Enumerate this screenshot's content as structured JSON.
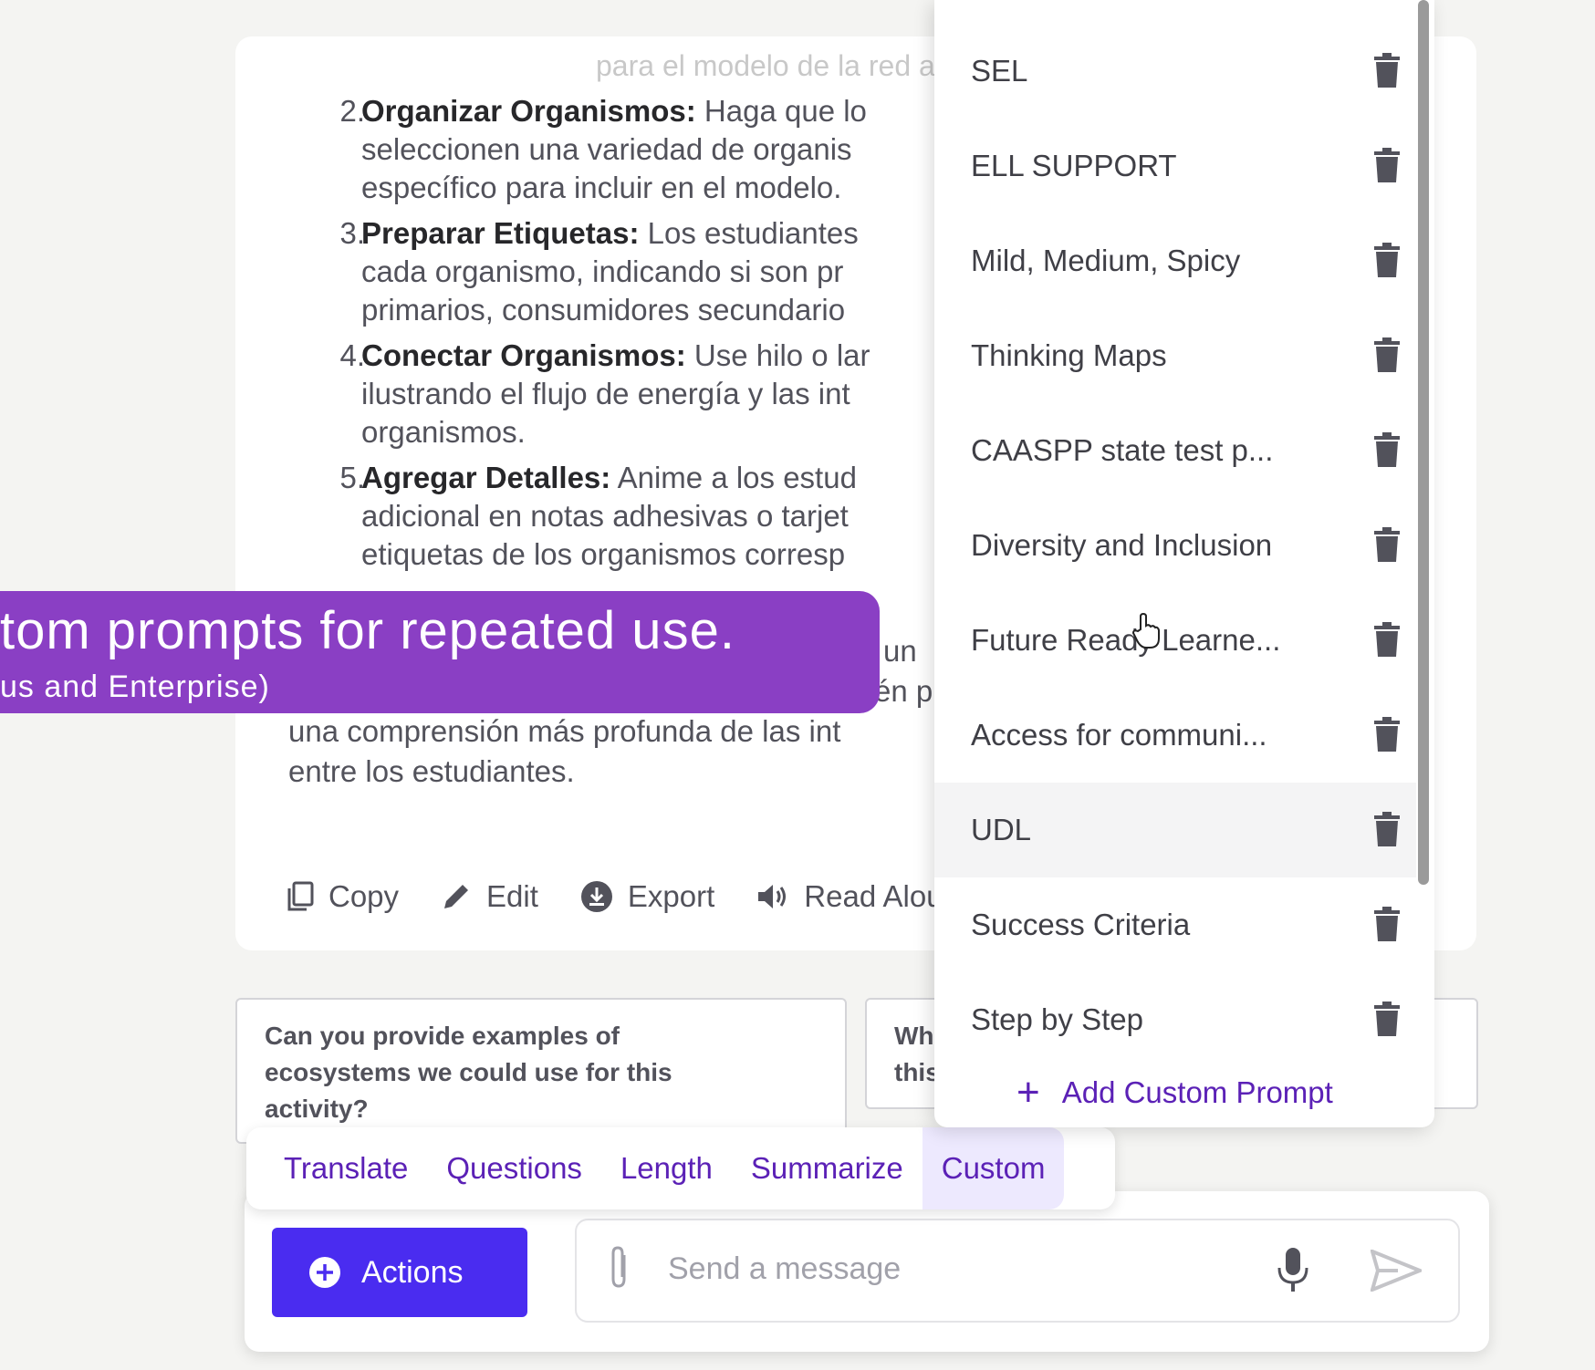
{
  "response": {
    "faded_line": "para el modelo de la red alimentaria",
    "steps": [
      {
        "num": "2.",
        "lines": [
          {
            "bold": "Organizar Organismos:",
            "text": " Haga que lo"
          },
          {
            "bold": "",
            "text": "seleccionen una variedad de organis"
          },
          {
            "bold": "",
            "text": "específico para incluir en el modelo."
          }
        ]
      },
      {
        "num": "3.",
        "lines": [
          {
            "bold": "Preparar Etiquetas:",
            "text": " Los estudiantes"
          },
          {
            "bold": "",
            "text": "cada organismo, indicando si son pr"
          },
          {
            "bold": "",
            "text": "primarios, consumidores secundario"
          }
        ]
      },
      {
        "num": "4.",
        "lines": [
          {
            "bold": "Conectar Organismos:",
            "text": " Use hilo o lar"
          },
          {
            "bold": "",
            "text": "ilustrando el flujo de energía y las int"
          },
          {
            "bold": "",
            "text": "organismos."
          }
        ]
      },
      {
        "num": "5.",
        "lines": [
          {
            "bold": "Agregar Detalles:",
            "text": " Anime a los estud"
          },
          {
            "bold": "",
            "text": "adicional en notas adhesivas o tarjet"
          },
          {
            "bold": "",
            "text": "etiquetas de los organismos corresp"
          }
        ]
      }
    ],
    "para_lines": [
      "un",
      "én p",
      "una comprensión más profunda de las int",
      "entre los estudiantes."
    ]
  },
  "toolbar": {
    "copy": "Copy",
    "edit": "Edit",
    "export": "Export",
    "read_aloud": "Read Alou"
  },
  "suggestions": [
    "Can you provide examples of ecosystems we could use for this activity?",
    "Wh this"
  ],
  "tabs": [
    {
      "label": "Translate",
      "active": false
    },
    {
      "label": "Questions",
      "active": false
    },
    {
      "label": "Length",
      "active": false
    },
    {
      "label": "Summarize",
      "active": false
    },
    {
      "label": "Custom",
      "active": true
    }
  ],
  "input": {
    "actions_label": "Actions",
    "placeholder": "Send a message"
  },
  "callout": {
    "title": "tom prompts for repeated use.",
    "subtitle": "us and Enterprise)"
  },
  "custom_prompts": {
    "items": [
      "SEL",
      "ELL SUPPORT",
      "Mild, Medium, Spicy",
      "Thinking Maps",
      "CAASPP state test p...",
      "Diversity and Inclusion",
      "Future Ready Learne...",
      "Access for communi...",
      "UDL",
      "Success Criteria",
      "Step by Step"
    ],
    "hover_item": "UDL",
    "add_label": "Add Custom Prompt"
  },
  "colors": {
    "accent": "#4a2cf0",
    "tab_text": "#5b21b6",
    "callout": "#8a3fc4"
  }
}
